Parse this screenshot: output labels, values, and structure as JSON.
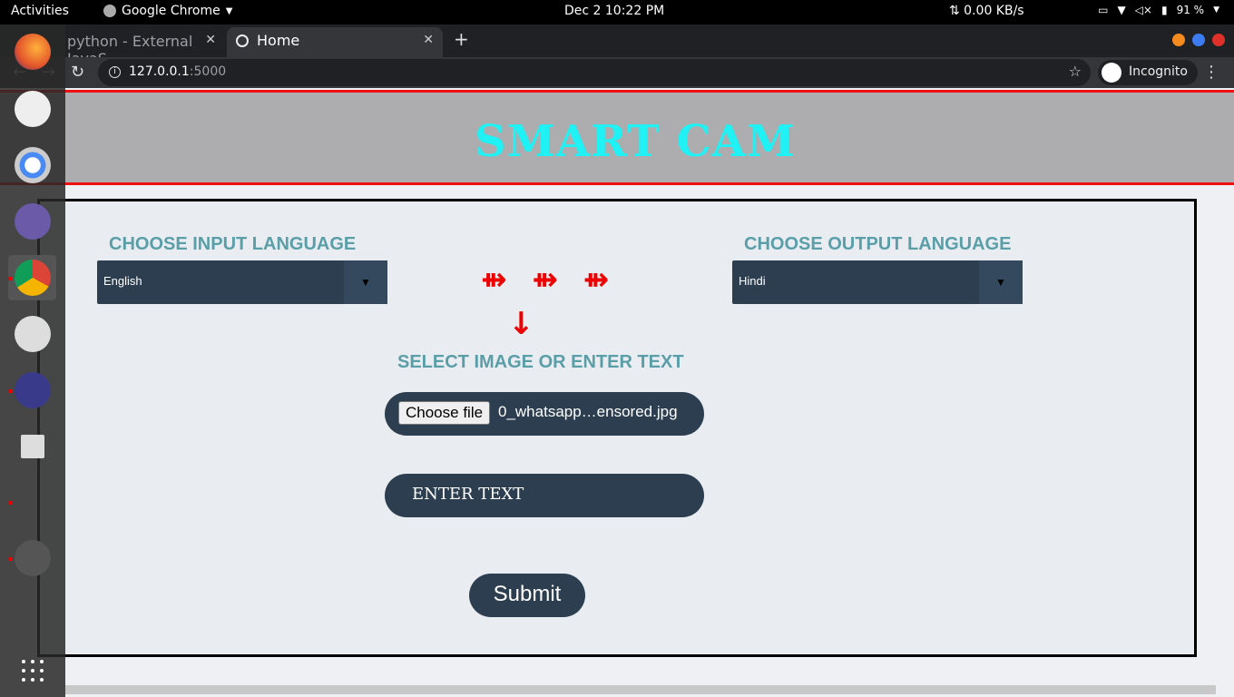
{
  "topbar": {
    "activities": "Activities",
    "app_name": "Google Chrome",
    "datetime": "Dec 2  10:22 PM",
    "network_speed": "⇅ 0.00 KB/s",
    "battery": "91 %"
  },
  "browser": {
    "tabs": [
      {
        "label": "python - External JavaS",
        "active": false
      },
      {
        "label": "Home",
        "active": true
      }
    ],
    "url_host": "127.0.0.1",
    "url_port": ":5000",
    "profile_label": "Incognito"
  },
  "page": {
    "title": "SMART CAM",
    "input_language_label": "CHOOSE INPUT LANGUAGE",
    "input_language_value": "English",
    "output_language_label": "CHOOSE OUTPUT LANGUAGE",
    "output_language_value": "Hindi",
    "flow_arrows": "⇻ ⇻ ⇻",
    "down_arrow": "↓",
    "select_prompt": "SELECT IMAGE OR ENTER TEXT",
    "file_button_label": "Choose file",
    "file_name": "0_whatsapp…ensored.jpg",
    "text_input_placeholder": "ENTER TEXT",
    "submit_label": "Submit"
  },
  "colors": {
    "title": "#1ff1f5",
    "label": "#5a9ea8",
    "control_bg": "#2c3e50",
    "header_border": "#ee1111",
    "arrow": "#ee0000"
  }
}
